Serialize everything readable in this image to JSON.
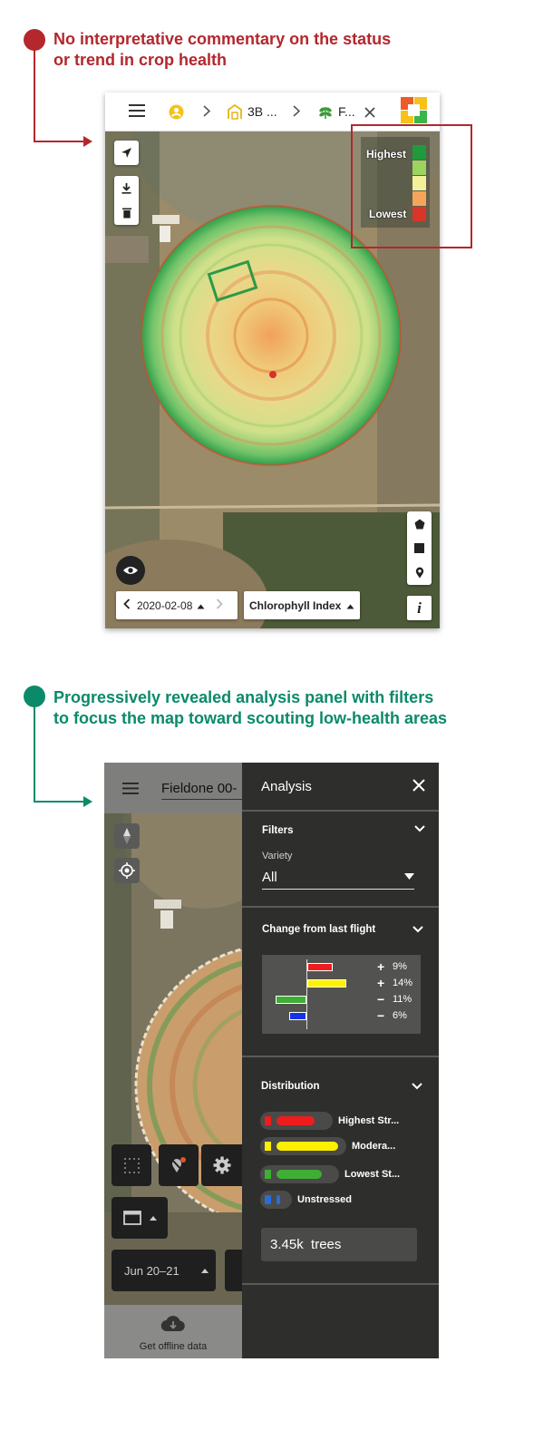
{
  "annotations": [
    {
      "line1": "No interpretative commentary on the  status",
      "line2": "or trend in crop health",
      "color": "#b3272d"
    },
    {
      "line1": "Progressively revealed analysis panel with filters",
      "line2": "to focus the map toward scouting low-health areas",
      "color": "#0b8a6a"
    }
  ],
  "screen1": {
    "breadcrumb": {
      "farm": "3B ...",
      "field": "F..."
    },
    "icons": [
      "menu-icon",
      "user-icon",
      "chevron-right-icon",
      "barn-icon",
      "leaf-icon",
      "close-icon",
      "app-logo"
    ],
    "legend": {
      "high_label": "Highest",
      "low_label": "Lowest",
      "colors": [
        "#1f9a3c",
        "#9cd45e",
        "#f4f09a",
        "#f5a55a",
        "#d9352a"
      ]
    },
    "date": "2020-02-08",
    "layer": "Chlorophyll Index",
    "info": "i"
  },
  "screen2": {
    "header_title": "Fieldone 00-",
    "panel_title": "Analysis",
    "filters": {
      "title": "Filters",
      "variety_label": "Variety",
      "variety_value": "All"
    },
    "change": {
      "title": "Change from last flight",
      "rows": [
        {
          "sign": "+",
          "pct": "9%",
          "value": 9,
          "color": "#ee1c1c"
        },
        {
          "sign": "+",
          "pct": "14%",
          "value": 14,
          "color": "#ffef00"
        },
        {
          "sign": "−",
          "pct": "11%",
          "value": -11,
          "color": "#3fae34"
        },
        {
          "sign": "−",
          "pct": "6%",
          "value": -6,
          "color": "#1533e6"
        }
      ]
    },
    "distribution": {
      "title": "Distribution",
      "rows": [
        {
          "label": "Highest Str...",
          "color": "#ee1c1c",
          "level": 0.75
        },
        {
          "label": "Modera...",
          "color": "#ffef00",
          "level": 0.96
        },
        {
          "label": "Lowest St...",
          "color": "#3fae34",
          "level": 0.8
        },
        {
          "label": "Unstressed",
          "color": "#2a6cd6",
          "level": 0.12
        }
      ],
      "total": "3.45k  trees"
    },
    "date_range": "Jun 20–21",
    "offline_label": "Get offline data"
  }
}
